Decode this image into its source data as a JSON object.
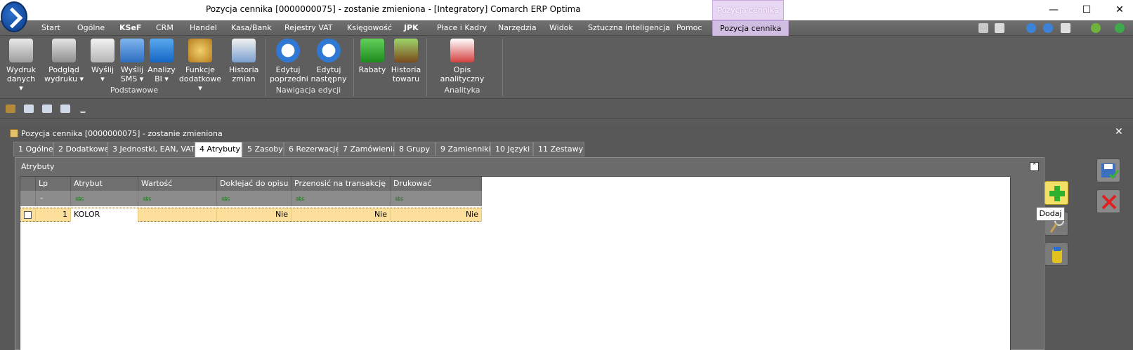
{
  "window": {
    "title": "Pozycja cennika [0000000075] - zostanie zmieniona - [Integratory] Comarch ERP Optima",
    "context_tab": "Pozycja cennika",
    "minimize": "—",
    "maximize": "☐",
    "close": "✕"
  },
  "menu": {
    "items": [
      "Start",
      "Ogólne",
      "KSeF",
      "CRM",
      "Handel",
      "Kasa/Bank",
      "Rejestry VAT",
      "Księgowość",
      "JPK",
      "Płace i Kadry",
      "Narzędzia",
      "Widok",
      "Sztuczna inteligencja",
      "Pomoc",
      "Pozycja cennika"
    ]
  },
  "ribbon": {
    "buttons": [
      {
        "line1": "Wydruk",
        "line2": "danych ▾"
      },
      {
        "line1": "Podgląd",
        "line2": "wydruku ▾"
      },
      {
        "line1": "Wyślij",
        "line2": "▾"
      },
      {
        "line1": "Wyślij",
        "line2": "SMS ▾"
      },
      {
        "line1": "Analizy",
        "line2": "BI ▾"
      },
      {
        "line1": "Funkcje",
        "line2": "dodatkowe ▾"
      },
      {
        "line1": "Historia",
        "line2": "zmian"
      },
      {
        "line1": "Edytuj",
        "line2": "poprzedni"
      },
      {
        "line1": "Edytuj",
        "line2": "następny"
      },
      {
        "line1": "Rabaty",
        "line2": ""
      },
      {
        "line1": "Historia",
        "line2": "towaru"
      },
      {
        "line1": "Opis analityczny",
        "line2": ""
      }
    ],
    "groups": [
      "Podstawowe",
      "Nawigacja edycji",
      "Analityka"
    ]
  },
  "document": {
    "title": "Pozycja cennika [0000000075] - zostanie zmieniona",
    "close": "✕",
    "tabs": [
      "1 Ogólne",
      "2 Dodatkowe",
      "3 Jednostki, EAN, VAT",
      "4 Atrybuty",
      "5 Zasoby",
      "6 Rezerwacje",
      "7 Zamówienia",
      "8 Grupy",
      "9 Zamienniki",
      "10 Języki",
      "11 Zestawy"
    ],
    "active_tab": "4 Atrybuty"
  },
  "panel": {
    "title": "Atrybuty",
    "collapse": "⌃",
    "columns": [
      "Lp",
      "Atrybut",
      "Wartość",
      "Doklejać do opisu",
      "Przenosić na transakcję",
      "Drukować"
    ],
    "filter_marker": "a͟b͟c",
    "rows": [
      {
        "lp": "1",
        "atrybut": "KOLOR",
        "wartosc": "",
        "doklejac": "Nie",
        "przenosic": "Nie",
        "drukowac": "Nie"
      }
    ]
  },
  "side": {
    "tooltip": "Dodaj"
  },
  "colors": {
    "accent_context": "#d0bde2",
    "row_selected": "#fbdf9a",
    "background": "#5a5a5a"
  }
}
